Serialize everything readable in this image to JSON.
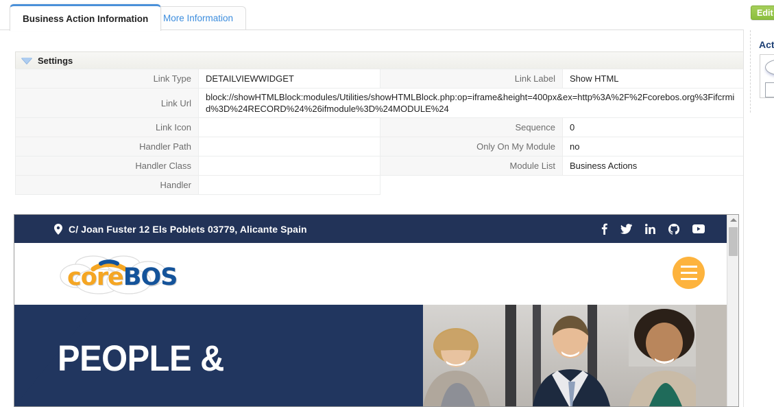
{
  "tabs": [
    {
      "label": "Business Action Information",
      "active": true
    },
    {
      "label": "More Information",
      "active": false
    }
  ],
  "settings": {
    "header_label": "Settings",
    "collapse_icon": "triangle-down-icon",
    "rows": [
      {
        "label": "Link Type",
        "value": "DETAILVIEWWIDGET",
        "label2": "Link Label",
        "value2": "Show HTML"
      },
      {
        "label": "Link Icon",
        "value": "",
        "label2": "Sequence",
        "value2": "0"
      },
      {
        "label": "Handler Path",
        "value": "",
        "label2": "Only On My Module",
        "value2": "no"
      },
      {
        "label": "Handler Class",
        "value": "",
        "label2": "Module List",
        "value2": "Business Actions"
      },
      {
        "label": "Handler",
        "value": "",
        "label2": "",
        "value2": ""
      }
    ],
    "url_row": {
      "label": "Link Url",
      "value": "block://showHTMLBlock:modules/Utilities/showHTMLBlock.php:op=iframe&height=400px&ex=http%3A%2F%2Fcorebos.org%3Fifcrmid%3D%24RECORD%24%26ifmodule%3D%24MODULE%24"
    }
  },
  "preview": {
    "topbar": {
      "pin_icon": "map-pin-icon",
      "address": "C/ Joan Fuster 12 Els Poblets 03779, Alicante Spain",
      "socials": [
        {
          "name": "facebook-icon",
          "glyph": "f"
        },
        {
          "name": "twitter-icon",
          "glyph": "t"
        },
        {
          "name": "linkedin-icon",
          "glyph": "in"
        },
        {
          "name": "github-icon",
          "glyph": "g"
        },
        {
          "name": "youtube-icon",
          "glyph": "y"
        }
      ],
      "background": "#223358"
    },
    "logo": {
      "text_part1": "core",
      "text_part2": "BOS",
      "color1": "#F5A623",
      "color2": "#14539A",
      "menu_icon": "hamburger-menu-icon",
      "menu_color": "#FDB33D"
    },
    "hero": {
      "title": "PEOPLE &",
      "background": "#21365F",
      "photo_alt": "three-business-people-photo"
    },
    "scrollbar": {
      "up_arrow_icon": "scroll-up-arrow-icon"
    }
  },
  "right_panel": {
    "edit_label": "Edit",
    "edit_color": "#8cbf3f",
    "panel_title": "Act",
    "oval_control": "oval-toggle",
    "square_control": "square-checkbox"
  }
}
